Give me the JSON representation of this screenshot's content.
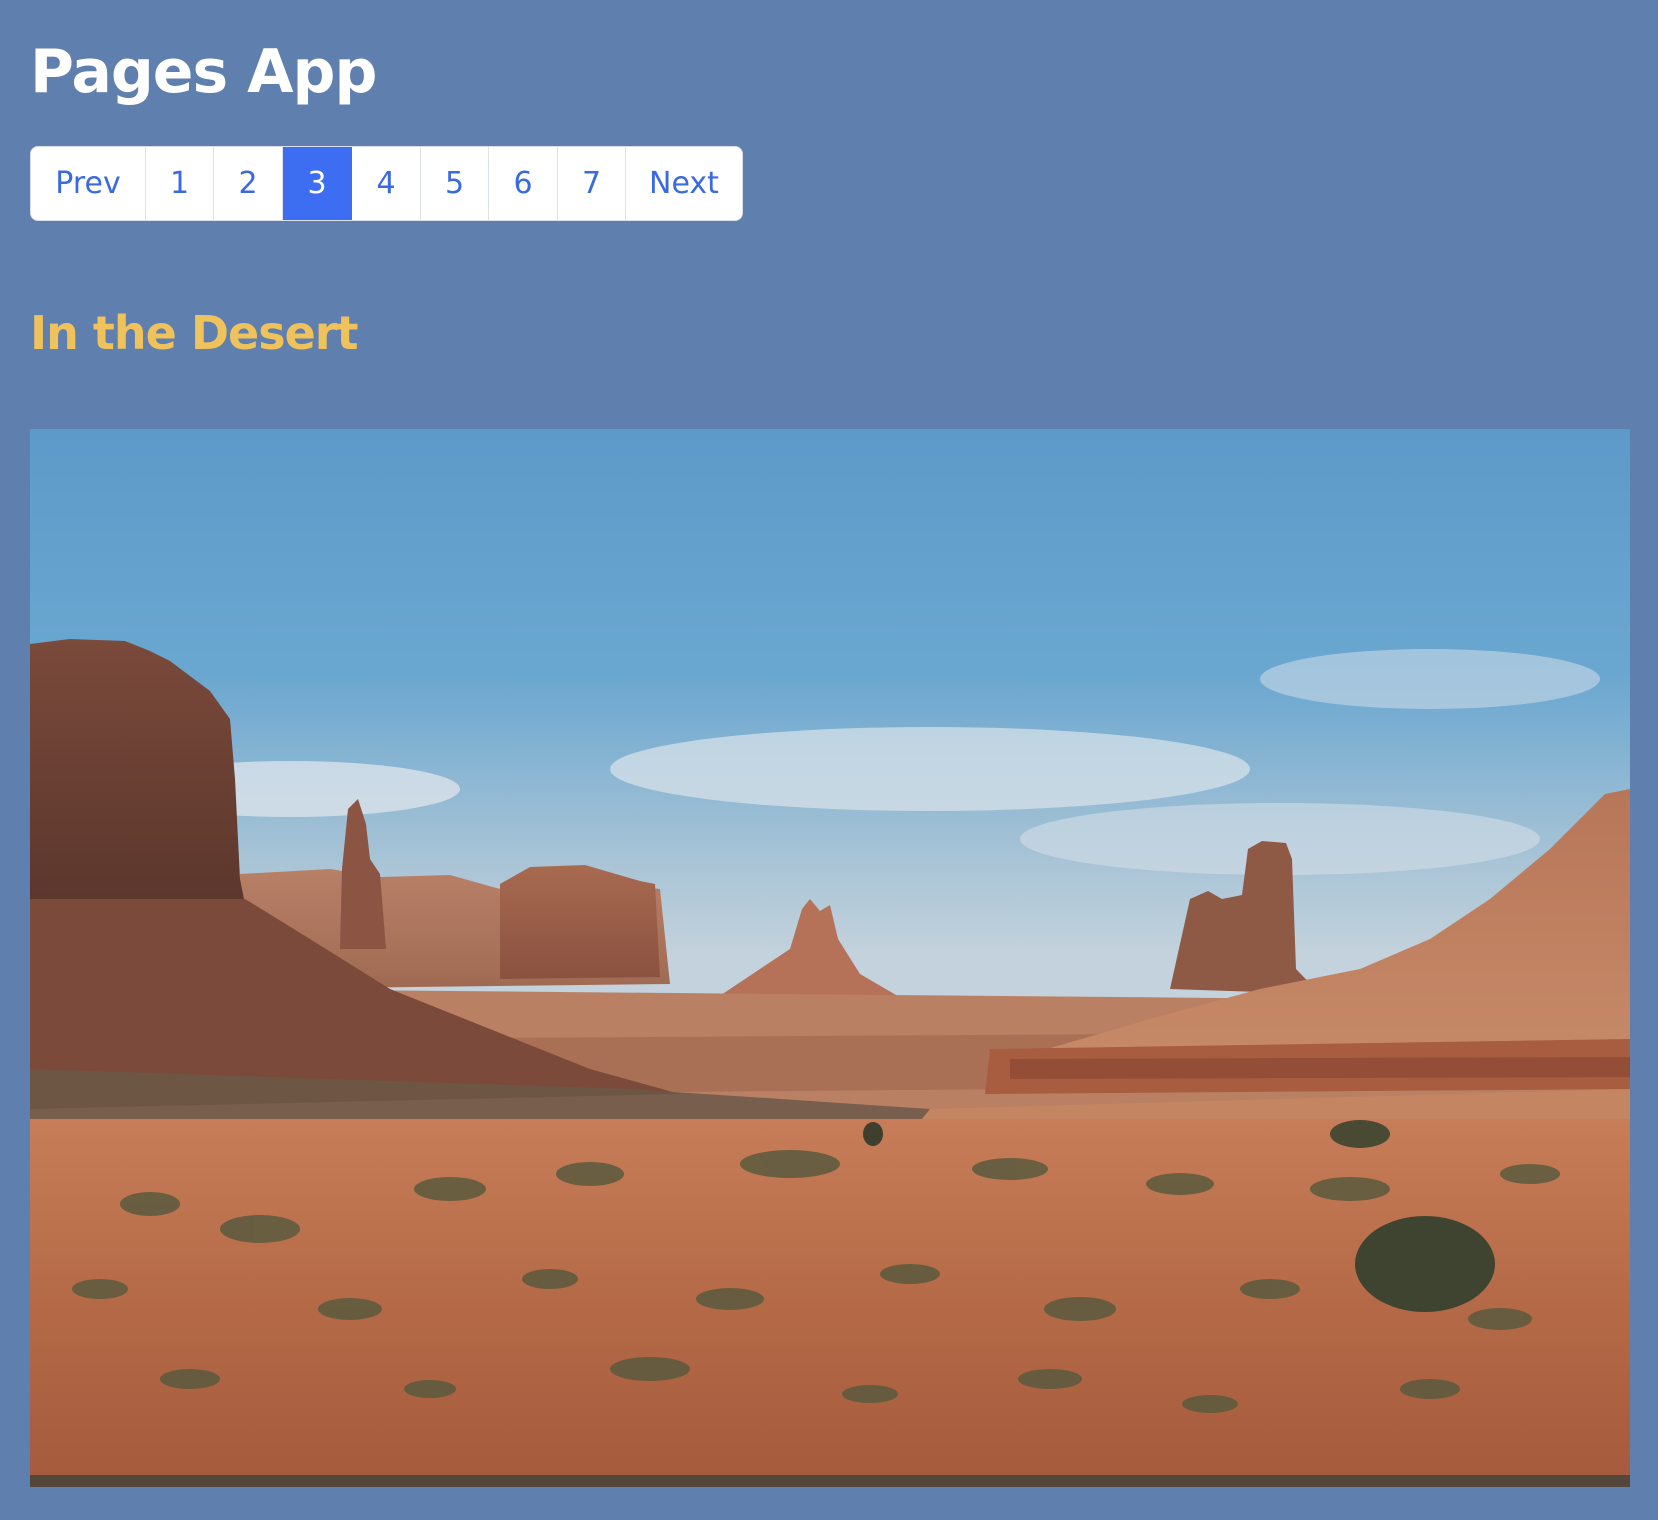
{
  "header": {
    "title": "Pages App"
  },
  "pagination": {
    "prev_label": "Prev",
    "next_label": "Next",
    "pages": [
      "1",
      "2",
      "3",
      "4",
      "5",
      "6",
      "7"
    ],
    "current_page": "3",
    "active_color": "#3d6ef2",
    "link_color": "#3a6ae0"
  },
  "content": {
    "section_title": "In the Desert",
    "image_subject": "desert landscape with sandstone buttes and mesas",
    "title_color": "#efc25c"
  },
  "colors": {
    "page_background": "#5f7fae"
  }
}
